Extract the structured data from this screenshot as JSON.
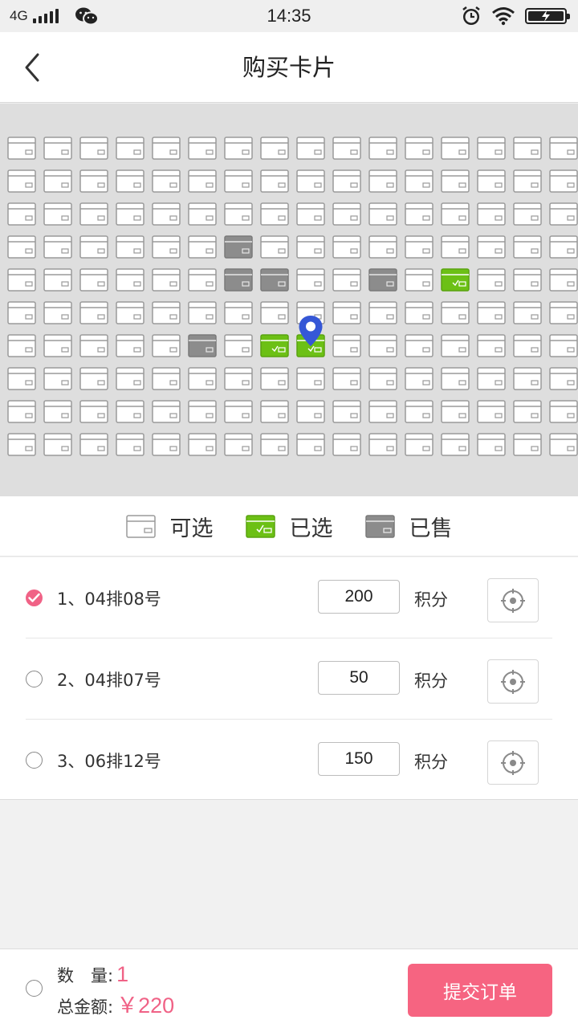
{
  "status_bar": {
    "network": "4G",
    "time": "14:35",
    "icons": [
      "signal-icon",
      "wechat-icon",
      "alarm-icon",
      "wifi-icon",
      "battery-charging-icon"
    ]
  },
  "header": {
    "title": "购买卡片",
    "back_icon": "chevron-left-icon"
  },
  "seat_map": {
    "rows": 10,
    "columns": 16,
    "sold": [
      [
        3,
        6
      ],
      [
        4,
        6
      ],
      [
        4,
        7
      ],
      [
        4,
        10
      ],
      [
        6,
        5
      ]
    ],
    "selected": [
      [
        4,
        12
      ],
      [
        6,
        7
      ],
      [
        6,
        8
      ]
    ],
    "marker": [
      6,
      8
    ],
    "marker_icon": "location-pin-icon",
    "colors": {
      "available_border": "#9a9a9a",
      "selected": "#6cc015",
      "sold": "#8c8c8c",
      "marker": "#3557d6"
    }
  },
  "legend": {
    "available": "可选",
    "selected": "已选",
    "sold": "已售"
  },
  "items": [
    {
      "label": "1、04排08号",
      "points": "200",
      "unit": "积分",
      "checked": true
    },
    {
      "label": "2、04排07号",
      "points": "50",
      "unit": "积分",
      "checked": false
    },
    {
      "label": "3、06排12号",
      "points": "150",
      "unit": "积分",
      "checked": false
    }
  ],
  "summary": {
    "quantity_label": "数　量:",
    "quantity": "1",
    "total_label": "总金额:",
    "total": "￥220"
  },
  "submit_label": "提交订单",
  "accent_color": "#f66481"
}
